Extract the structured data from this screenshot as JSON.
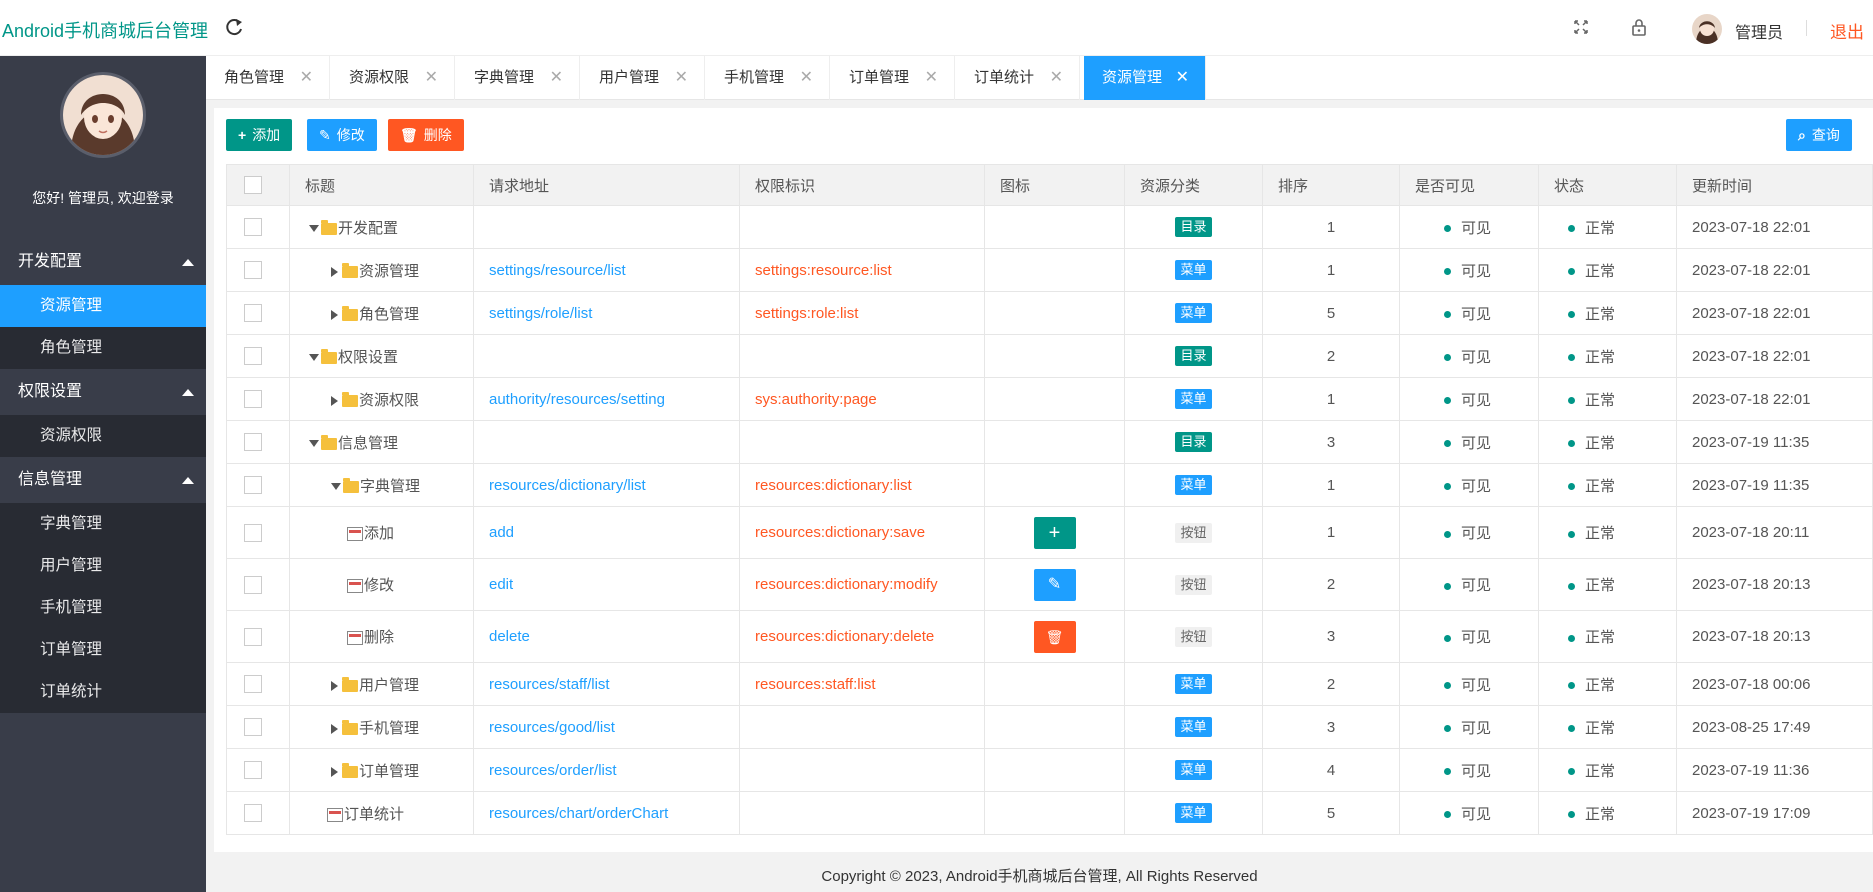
{
  "header": {
    "title": "Android手机商城后台管理",
    "user": "管理员",
    "logout": "退出"
  },
  "sidebar": {
    "welcome": "您好! 管理员, 欢迎登录",
    "groups": [
      {
        "label": "开发配置",
        "items": [
          "资源管理",
          "角色管理"
        ]
      },
      {
        "label": "权限设置",
        "items": [
          "资源权限"
        ]
      },
      {
        "label": "信息管理",
        "items": [
          "字典管理",
          "用户管理",
          "手机管理",
          "订单管理",
          "订单统计"
        ]
      }
    ]
  },
  "tabs": [
    "角色管理",
    "资源权限",
    "字典管理",
    "用户管理",
    "手机管理",
    "订单管理",
    "订单统计",
    "资源管理"
  ],
  "toolbar": {
    "add": "添加",
    "edit": "修改",
    "del": "删除",
    "search": "查询"
  },
  "table": {
    "headers": [
      "标题",
      "请求地址",
      "权限标识",
      "图标",
      "资源分类",
      "排序",
      "是否可见",
      "状态",
      "更新时间"
    ],
    "rows": [
      {
        "title": "开发配置",
        "url": "",
        "perm": "",
        "type": "目录",
        "sort": "1",
        "visible": "可见",
        "status": "正常",
        "time": "2023-07-18 22:01"
      },
      {
        "title": "资源管理",
        "url": "settings/resource/list",
        "perm": "settings:resource:list",
        "type": "菜单",
        "sort": "1",
        "visible": "可见",
        "status": "正常",
        "time": "2023-07-18 22:01"
      },
      {
        "title": "角色管理",
        "url": "settings/role/list",
        "perm": "settings:role:list",
        "type": "菜单",
        "sort": "5",
        "visible": "可见",
        "status": "正常",
        "time": "2023-07-18 22:01"
      },
      {
        "title": "权限设置",
        "url": "",
        "perm": "",
        "type": "目录",
        "sort": "2",
        "visible": "可见",
        "status": "正常",
        "time": "2023-07-18 22:01"
      },
      {
        "title": "资源权限",
        "url": "authority/resources/setting",
        "perm": "sys:authority:page",
        "type": "菜单",
        "sort": "1",
        "visible": "可见",
        "status": "正常",
        "time": "2023-07-18 22:01"
      },
      {
        "title": "信息管理",
        "url": "",
        "perm": "",
        "type": "目录",
        "sort": "3",
        "visible": "可见",
        "status": "正常",
        "time": "2023-07-19 11:35"
      },
      {
        "title": "字典管理",
        "url": "resources/dictionary/list",
        "perm": "resources:dictionary:list",
        "type": "菜单",
        "sort": "1",
        "visible": "可见",
        "status": "正常",
        "time": "2023-07-19 11:35"
      },
      {
        "title": "添加",
        "url": "add",
        "perm": "resources:dictionary:save",
        "type": "按钮",
        "sort": "1",
        "visible": "可见",
        "status": "正常",
        "time": "2023-07-18 20:11"
      },
      {
        "title": "修改",
        "url": "edit",
        "perm": "resources:dictionary:modify",
        "type": "按钮",
        "sort": "2",
        "visible": "可见",
        "status": "正常",
        "time": "2023-07-18 20:13"
      },
      {
        "title": "删除",
        "url": "delete",
        "perm": "resources:dictionary:delete",
        "type": "按钮",
        "sort": "3",
        "visible": "可见",
        "status": "正常",
        "time": "2023-07-18 20:13"
      },
      {
        "title": "用户管理",
        "url": "resources/staff/list",
        "perm": "resources:staff:list",
        "type": "菜单",
        "sort": "2",
        "visible": "可见",
        "status": "正常",
        "time": "2023-07-18 00:06"
      },
      {
        "title": "手机管理",
        "url": "resources/good/list",
        "perm": "",
        "type": "菜单",
        "sort": "3",
        "visible": "可见",
        "status": "正常",
        "time": "2023-08-25 17:49"
      },
      {
        "title": "订单管理",
        "url": "resources/order/list",
        "perm": "",
        "type": "菜单",
        "sort": "4",
        "visible": "可见",
        "status": "正常",
        "time": "2023-07-19 11:36"
      },
      {
        "title": "订单统计",
        "url": "resources/chart/orderChart",
        "perm": "",
        "type": "菜单",
        "sort": "5",
        "visible": "可见",
        "status": "正常",
        "time": "2023-07-19 17:09"
      }
    ]
  },
  "footer": "Copyright © 2023, Android手机商城后台管理, All Rights Reserved"
}
